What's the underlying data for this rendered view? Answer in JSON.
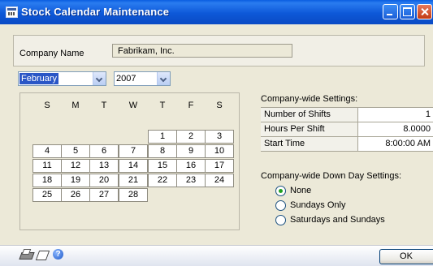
{
  "window": {
    "title": "Stock Calendar Maintenance"
  },
  "company": {
    "label": "Company Name",
    "value": "Fabrikam, Inc."
  },
  "month_select": {
    "value": "February"
  },
  "year_select": {
    "value": "2007"
  },
  "calendar": {
    "weekdays": [
      "S",
      "M",
      "T",
      "W",
      "T",
      "F",
      "S"
    ],
    "days": [
      "1",
      "2",
      "3",
      "4",
      "5",
      "6",
      "7",
      "8",
      "9",
      "10",
      "11",
      "12",
      "13",
      "14",
      "15",
      "16",
      "17",
      "18",
      "19",
      "20",
      "21",
      "22",
      "23",
      "24",
      "25",
      "26",
      "27",
      "28"
    ]
  },
  "settings": {
    "heading": "Company-wide Settings:",
    "rows": [
      {
        "label": "Number of Shifts",
        "value": "1"
      },
      {
        "label": "Hours Per Shift",
        "value": "8.0000"
      },
      {
        "label": "Start Time",
        "value": "8:00:00 AM"
      }
    ]
  },
  "down_day": {
    "heading": "Company-wide Down Day Settings:",
    "options": [
      {
        "label": "None",
        "selected": true
      },
      {
        "label": "Sundays Only",
        "selected": false
      },
      {
        "label": "Saturdays and Sundays",
        "selected": false
      }
    ]
  },
  "footer": {
    "icons": [
      "printer-icon",
      "note-icon",
      "help-icon"
    ],
    "ok_label": "OK"
  }
}
